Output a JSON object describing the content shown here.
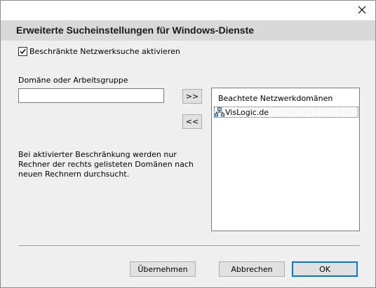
{
  "dialog": {
    "header_title": "Erweiterte Sucheinstellungen für Windows-Dienste"
  },
  "restrict_checkbox": {
    "label": "Beschränkte Netzwerksuche aktivieren",
    "checked": true
  },
  "domain_input": {
    "label": "Domäne oder Arbeitsgruppe",
    "value": ""
  },
  "transfer": {
    "add_label": ">>",
    "remove_label": "<<"
  },
  "info_text": "Bei aktivierter Beschränkung werden nur Rechner der rechts gelisteten Domänen nach neuen Rechnern durchsucht.",
  "domain_list": {
    "header": "Beachtete Netzwerkdomänen",
    "items": [
      {
        "label": "VisLogic.de",
        "icon": "network-domain-icon"
      }
    ]
  },
  "buttons": {
    "apply": "Übernehmen",
    "cancel": "Abbrechen",
    "ok": "OK"
  },
  "colors": {
    "header_band": "#d9d9d9",
    "dialog_bg": "#f0f0f0",
    "default_button_border": "#0078d7"
  }
}
